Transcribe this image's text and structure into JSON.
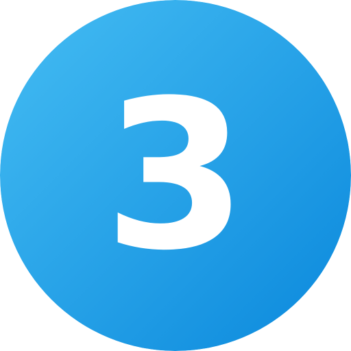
{
  "badge": {
    "number": "3",
    "icon": "number-three-icon",
    "colors": {
      "gradient_start": "#45BDF3",
      "gradient_end": "#0A88DC",
      "digit": "#FFFFFF"
    }
  }
}
